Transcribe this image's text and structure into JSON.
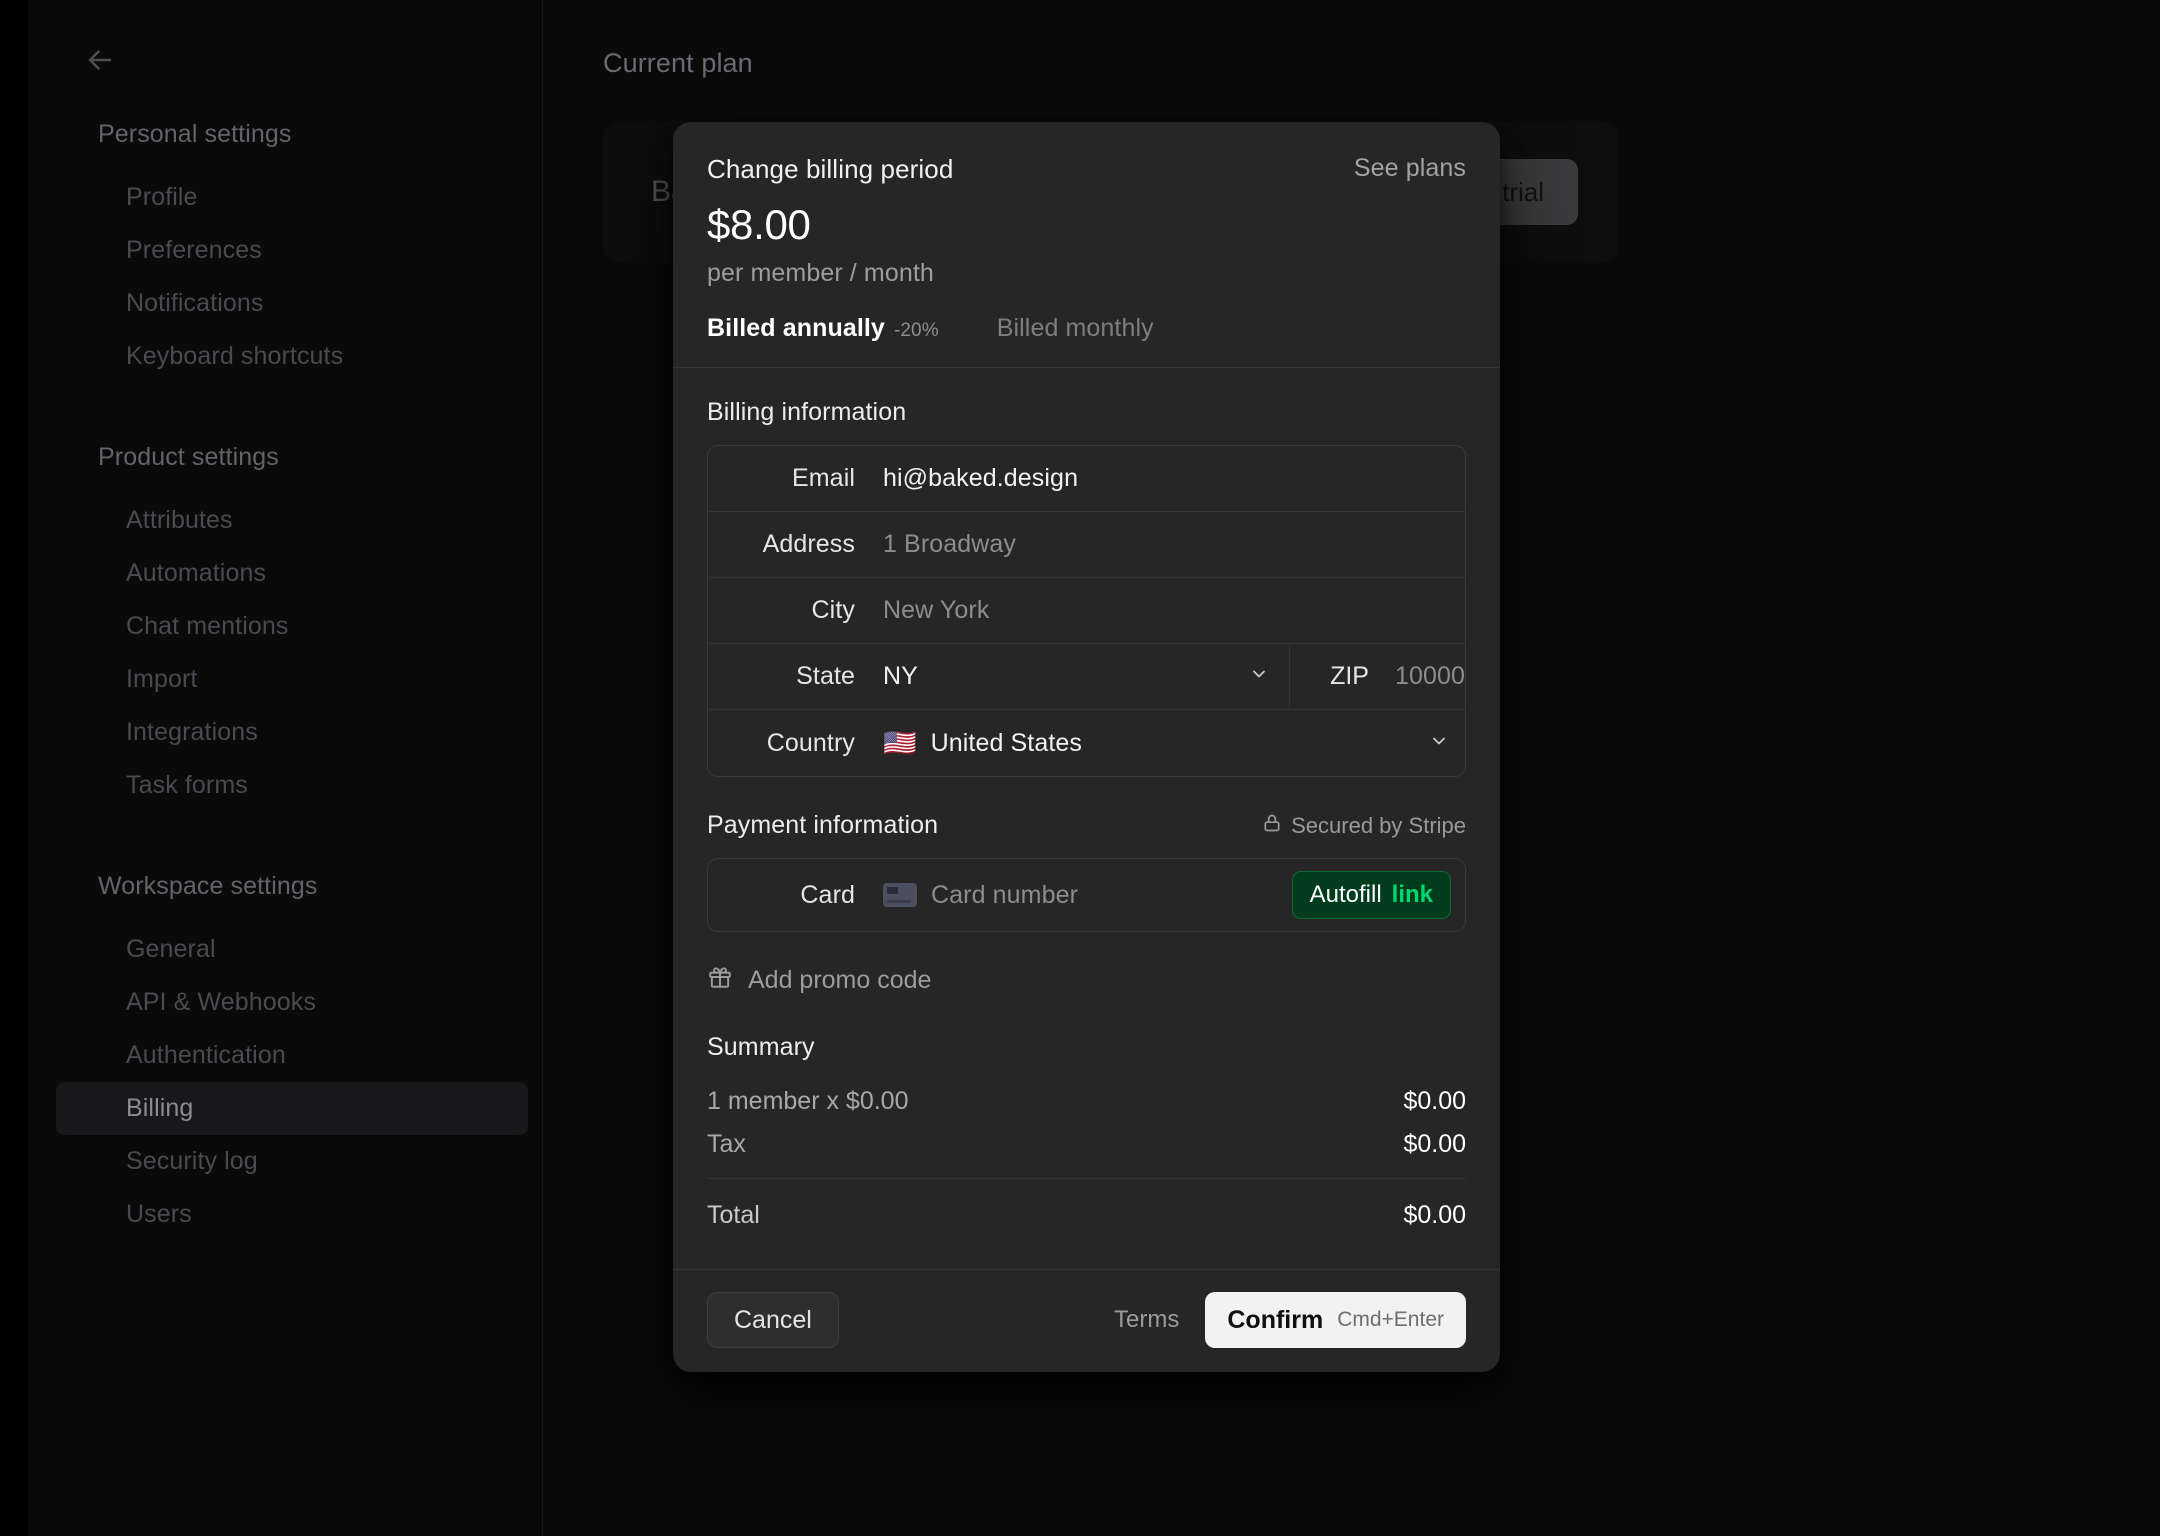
{
  "sidebar": {
    "back_icon": "arrow-left-icon",
    "groups": [
      {
        "title": "Personal settings",
        "items": [
          {
            "label": "Profile",
            "active": false
          },
          {
            "label": "Preferences",
            "active": false
          },
          {
            "label": "Notifications",
            "active": false
          },
          {
            "label": "Keyboard shortcuts",
            "active": false
          }
        ]
      },
      {
        "title": "Product settings",
        "items": [
          {
            "label": "Attributes",
            "active": false
          },
          {
            "label": "Automations",
            "active": false
          },
          {
            "label": "Chat mentions",
            "active": false
          },
          {
            "label": "Import",
            "active": false
          },
          {
            "label": "Integrations",
            "active": false
          },
          {
            "label": "Task forms",
            "active": false
          }
        ]
      },
      {
        "title": "Workspace settings",
        "items": [
          {
            "label": "General",
            "active": false
          },
          {
            "label": "API & Webhooks",
            "active": false
          },
          {
            "label": "Authentication",
            "active": false
          },
          {
            "label": "Billing",
            "active": true
          },
          {
            "label": "Security log",
            "active": false
          },
          {
            "label": "Users",
            "active": false
          }
        ]
      }
    ]
  },
  "main": {
    "title": "Current plan",
    "plan_name": "Basic",
    "trial_button": "Start free trial"
  },
  "modal": {
    "title": "Change billing period",
    "see_plans": "See plans",
    "price": "$8.00",
    "price_sub": "per member / month",
    "tabs": [
      {
        "label": "Billed annually",
        "discount": "-20%",
        "active": true
      },
      {
        "label": "Billed monthly",
        "discount": "",
        "active": false
      }
    ],
    "billing": {
      "section_title": "Billing information",
      "email_label": "Email",
      "email_value": "hi@baked.design",
      "address_label": "Address",
      "address_placeholder": "1 Broadway",
      "city_label": "City",
      "city_placeholder": "New York",
      "state_label": "State",
      "state_value": "NY",
      "zip_label": "ZIP",
      "zip_placeholder": "10000",
      "country_label": "Country",
      "country_flag": "🇺🇸",
      "country_value": "United States",
      "chevron_icon": "chevron-down-icon"
    },
    "payment": {
      "section_title": "Payment information",
      "secured_note": "Secured by Stripe",
      "lock_icon": "lock-icon",
      "card_label": "Card",
      "card_icon": "credit-card-icon",
      "card_placeholder": "Card number",
      "autofill_label": "Autofill",
      "autofill_brand": "link"
    },
    "promo": {
      "icon": "gift-icon",
      "label": "Add promo code"
    },
    "summary": {
      "title": "Summary",
      "rows": [
        {
          "label": "1 member x $0.00",
          "amount": "$0.00"
        },
        {
          "label": "Tax",
          "amount": "$0.00"
        }
      ],
      "total_label": "Total",
      "total_amount": "$0.00"
    },
    "footer": {
      "cancel": "Cancel",
      "terms": "Terms",
      "confirm": "Confirm",
      "confirm_hint": "Cmd+Enter"
    }
  },
  "colors": {
    "modal_bg": "#262626",
    "page_bg": "#0a0a0a",
    "accent_green": "#00d66f",
    "autofill_bg": "#013d1d"
  }
}
